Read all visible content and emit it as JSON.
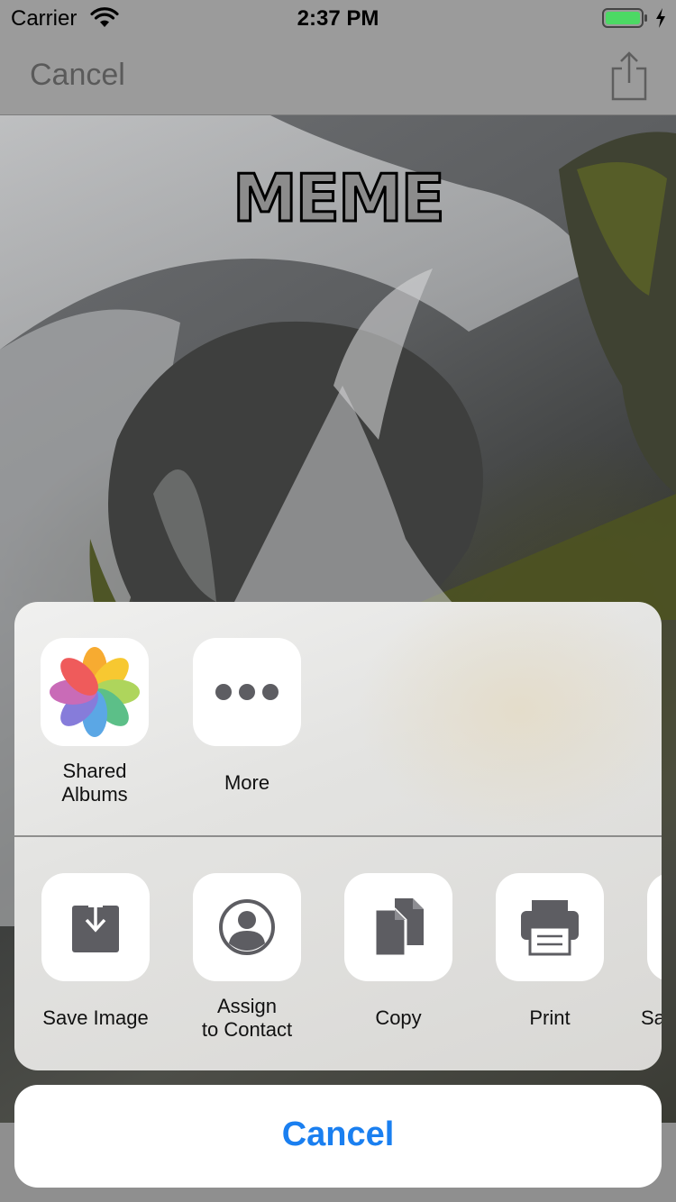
{
  "status_bar": {
    "carrier": "Carrier",
    "time": "2:37 PM",
    "battery_color": "#4cd964"
  },
  "nav": {
    "cancel_label": "Cancel",
    "share_icon": "share-icon"
  },
  "photo": {
    "meme_text": "MEME"
  },
  "share_sheet": {
    "apps": [
      {
        "label_line1": "Shared",
        "label_line2": "Albums",
        "icon": "photos-icon"
      },
      {
        "label_line1": "More",
        "label_line2": "",
        "icon": "more-icon"
      }
    ],
    "actions": [
      {
        "label_line1": "Save Image",
        "label_line2": "",
        "icon": "save-image-icon"
      },
      {
        "label_line1": "Assign",
        "label_line2": "to Contact",
        "icon": "contact-icon"
      },
      {
        "label_line1": "Copy",
        "label_line2": "",
        "icon": "copy-icon"
      },
      {
        "label_line1": "Print",
        "label_line2": "",
        "icon": "print-icon"
      },
      {
        "label_line1": "Sa",
        "label_line2": "",
        "icon": "partial-action-icon"
      }
    ],
    "cancel_label": "Cancel",
    "accent_color": "#1a7ff0"
  }
}
